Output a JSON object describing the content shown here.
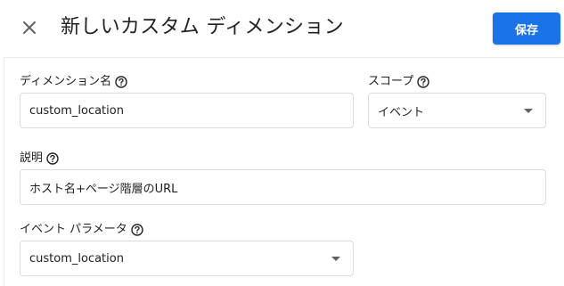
{
  "header": {
    "title": "新しいカスタム ディメンション",
    "save_label": "保存",
    "close_icon": "close-icon"
  },
  "form": {
    "dimension_name": {
      "label": "ディメンション名",
      "value": "custom_location"
    },
    "scope": {
      "label": "スコープ",
      "value": "イベント"
    },
    "description": {
      "label": "説明",
      "value": "ホスト名+ページ階層のURL"
    },
    "event_parameter": {
      "label": "イベント パラメータ",
      "value": "custom_location"
    }
  },
  "colors": {
    "accent": "#1a73e8",
    "border": "#dadce0",
    "icon": "#5f6368"
  }
}
